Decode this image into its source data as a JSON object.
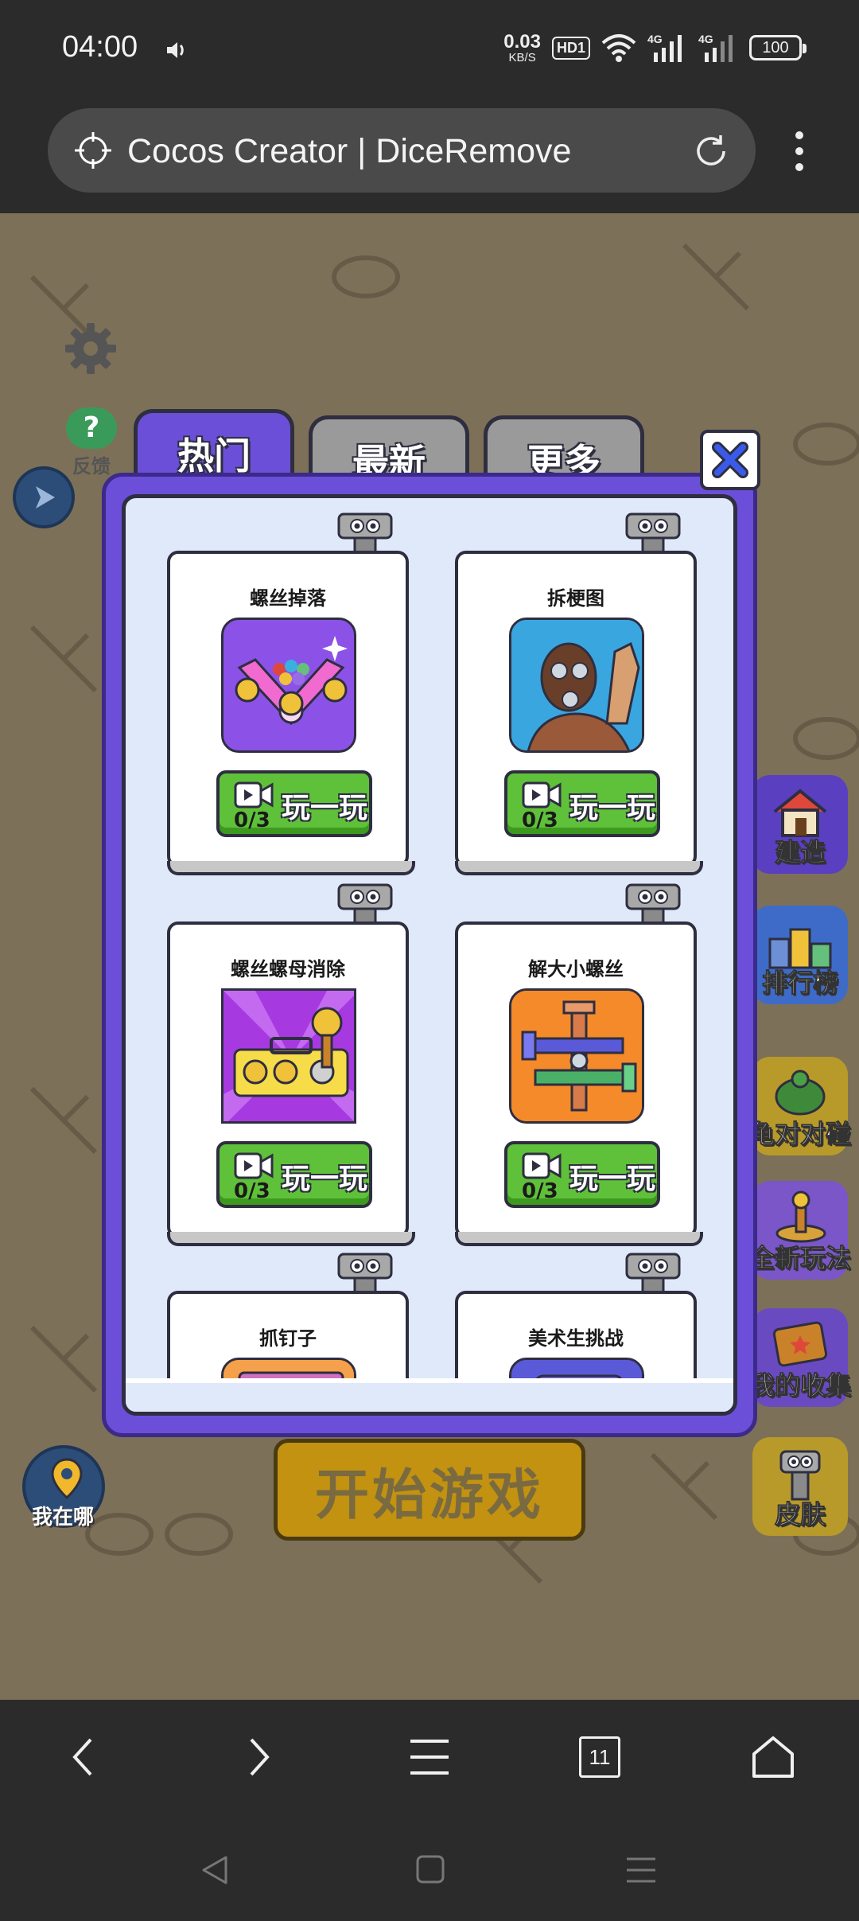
{
  "status_bar": {
    "time": "04:00",
    "net_speed": "0.03",
    "net_unit": "KB/S",
    "hd": "HD1",
    "signal1": "4G",
    "signal2": "4G",
    "battery": "100"
  },
  "browser": {
    "url_title": "Cocos Creator | DiceRemove",
    "tab_count": "11"
  },
  "game": {
    "feedback_label": "反馈",
    "where_label": "我在哪",
    "start_label": "开始游戏",
    "right_buttons": [
      "建造",
      "排行榜",
      "龟对对碰",
      "全新玩法",
      "我的收集",
      "皮肤"
    ]
  },
  "modal": {
    "tabs": [
      {
        "label": "热门",
        "active": true
      },
      {
        "label": "最新",
        "active": false
      },
      {
        "label": "更多",
        "active": false
      }
    ],
    "cards": [
      {
        "title": "螺丝掉落",
        "count": "0/3",
        "button": "玩一玩",
        "icon": "screw-drop-icon"
      },
      {
        "title": "拆梗图",
        "count": "0/3",
        "button": "玩一玩",
        "icon": "meme-unscrew-icon"
      },
      {
        "title": "螺丝螺母消除",
        "count": "0/3",
        "button": "玩一玩",
        "icon": "nut-match-icon"
      },
      {
        "title": "解大小螺丝",
        "count": "0/3",
        "button": "玩一玩",
        "icon": "big-small-screw-icon"
      },
      {
        "title": "抓钉子",
        "count": "",
        "button": "",
        "icon": "grab-nail-icon"
      },
      {
        "title": "美术生挑战",
        "count": "",
        "button": "",
        "icon": "art-challenge-icon"
      }
    ]
  },
  "colors": {
    "modal_purple": "#6b4fd8",
    "play_green": "#5fc13a",
    "panel_bg": "#dfe9f9",
    "game_bg": "#7d7058"
  }
}
